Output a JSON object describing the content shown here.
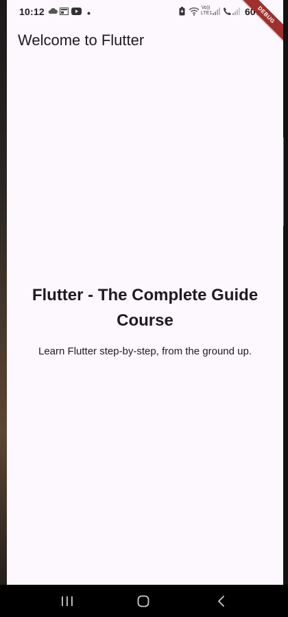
{
  "status_bar": {
    "time": "10:12",
    "battery": "60%",
    "network_label": "Vo)) LTE1",
    "icons": [
      "cloud-icon",
      "news-icon",
      "youtube-icon",
      "dot-icon",
      "battery-saver-icon",
      "wifi-icon",
      "signal-icon",
      "call-icon"
    ]
  },
  "debug_banner": "DEBUG",
  "app_bar": {
    "title": "Welcome to Flutter"
  },
  "body": {
    "heading": "Flutter - The Complete Guide Course",
    "subtitle": "Learn Flutter step-by-step, from the ground up."
  },
  "nav_bar": {
    "icons": [
      "recent-apps-icon",
      "home-icon",
      "back-icon"
    ]
  },
  "colors": {
    "background": "#fdf7fe",
    "text": "#1d1b20",
    "debug_banner": "#a0302d"
  }
}
